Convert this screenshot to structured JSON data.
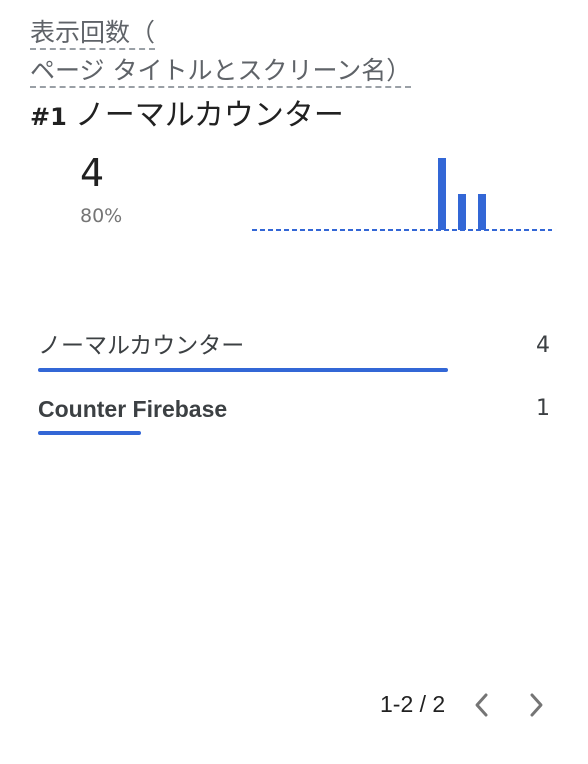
{
  "card": {
    "title": "表示回数（ページ タイトルとスクリーン名）",
    "title_line1": "表示回数（",
    "title_line2": "ページ タイトルとスクリーン名）"
  },
  "top_item": {
    "rank": "#1",
    "name": "ノーマルカウンター",
    "value": "4",
    "percent": "80%"
  },
  "sparkline": {
    "accent": "#3367d6",
    "values": [
      0,
      0,
      0,
      0,
      0,
      0,
      0,
      0,
      0,
      4,
      2,
      2,
      0,
      0,
      0
    ]
  },
  "rows": [
    {
      "label": "ノーマルカウンター",
      "value": "4",
      "fraction": 1.0
    },
    {
      "label": "Counter Firebase",
      "value": "1",
      "fraction": 0.25
    }
  ],
  "pagination": {
    "label": "1-2 / 2",
    "prev_icon": "chevron-left-icon",
    "next_icon": "chevron-right-icon"
  }
}
